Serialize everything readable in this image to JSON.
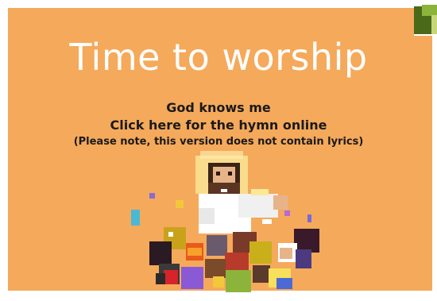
{
  "slide": {
    "background": "#f5a95b",
    "title": "Time to worship",
    "hymn_title": "God knows me",
    "hymn_link": "Click here for the hymn online",
    "note": "(Please note, this version does not contain lyrics)"
  },
  "colors": {
    "title_text": "#ffffff",
    "body_text": "#1a1a1a",
    "logo_dark": "#4a6a1a",
    "logo_light": "#8db43a"
  }
}
